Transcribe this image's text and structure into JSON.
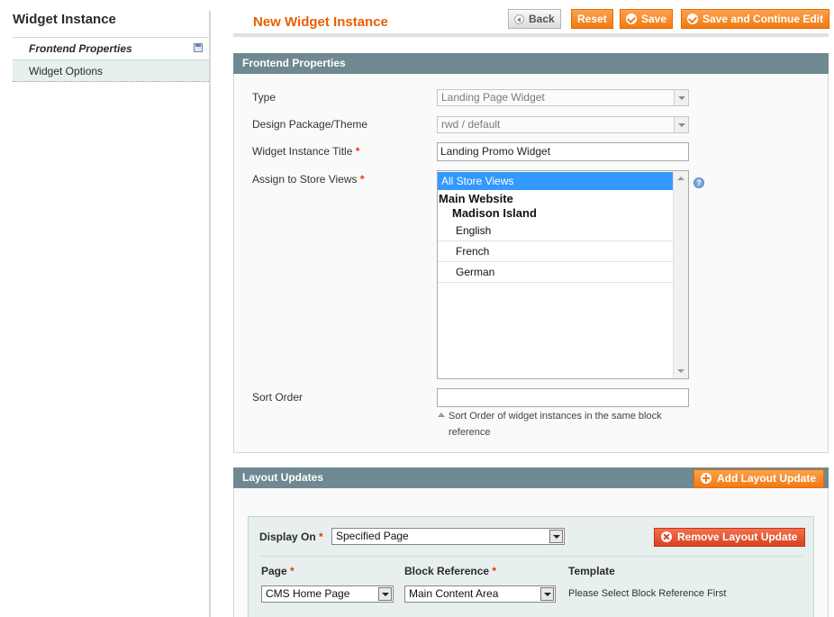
{
  "sidebar": {
    "title": "Widget Instance",
    "tabs": [
      {
        "label": "Frontend Properties",
        "active": true,
        "icon": "save-icon"
      },
      {
        "label": "Widget Options",
        "active": false
      }
    ]
  },
  "header": {
    "title": "New Widget Instance",
    "buttons": {
      "back": "Back",
      "reset": "Reset",
      "save": "Save",
      "save_continue": "Save and Continue Edit"
    }
  },
  "frontend": {
    "section_title": "Frontend Properties",
    "type": {
      "label": "Type",
      "value": "Landing Page Widget"
    },
    "design": {
      "label": "Design Package/Theme",
      "value": "rwd / default"
    },
    "title": {
      "label": "Widget Instance Title",
      "required_mark": "*",
      "value": "Landing Promo Widget"
    },
    "stores": {
      "label": "Assign to Store Views",
      "required_mark": "*",
      "selected_option": "All Store Views",
      "website": "Main Website",
      "store": "Madison Island",
      "views": [
        "English",
        "French",
        "German"
      ]
    },
    "sort_order": {
      "label": "Sort Order",
      "value": "",
      "note": "Sort Order of widget instances in the same block reference"
    }
  },
  "layout": {
    "section_title": "Layout Updates",
    "add_button": "Add Layout Update",
    "remove_button": "Remove Layout Update",
    "display_on": {
      "label": "Display On",
      "required_mark": "*",
      "value": "Specified Page"
    },
    "page": {
      "label": "Page",
      "required_mark": "*",
      "value": "CMS Home Page"
    },
    "block_reference": {
      "label": "Block Reference",
      "required_mark": "*",
      "value": "Main Content Area"
    },
    "template": {
      "label": "Template",
      "hint": "Please Select Block Reference First"
    }
  },
  "colors": {
    "accent": "#eb5e00",
    "button_orange": "#f17a12",
    "section_header": "#6f8992",
    "selection": "#3399ff",
    "required": "#eb340a"
  }
}
